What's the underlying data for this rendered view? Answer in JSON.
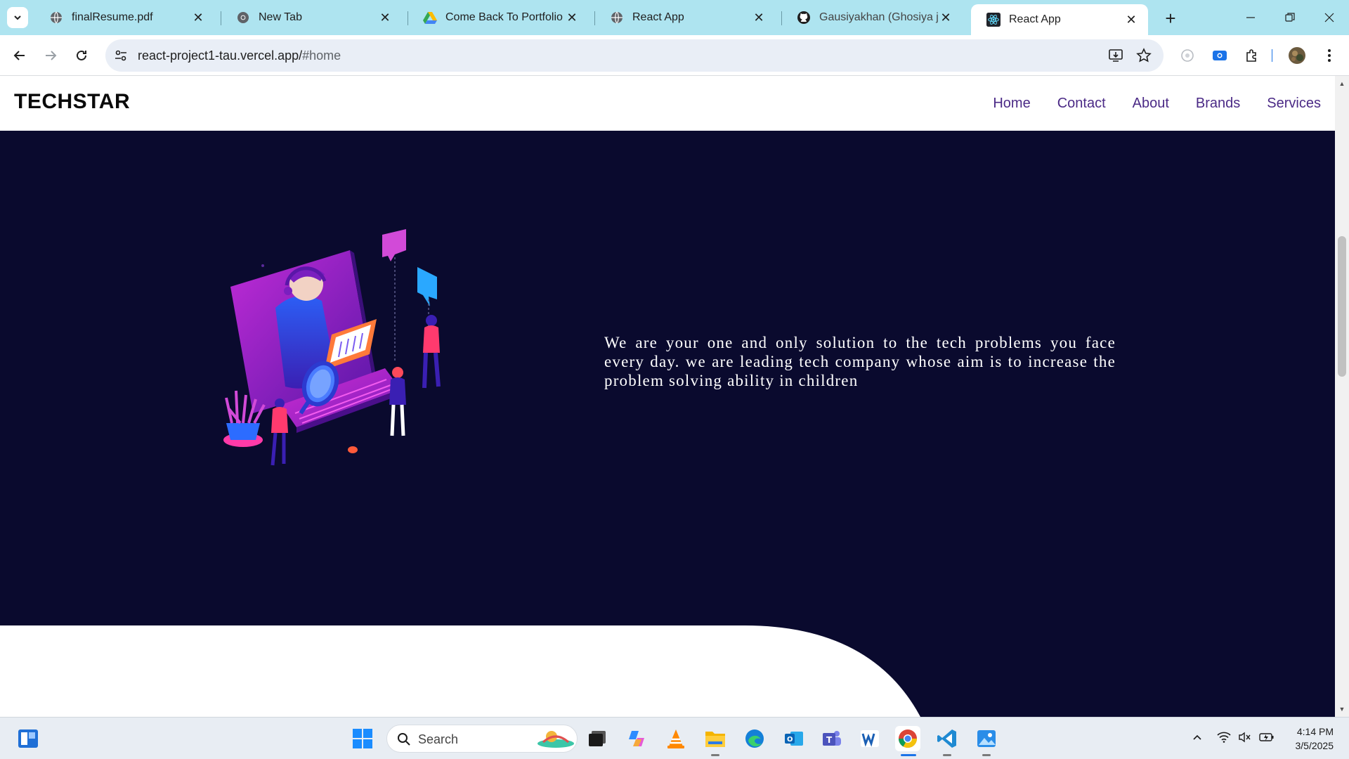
{
  "browser": {
    "tabs": [
      {
        "title": "finalResume.pdf",
        "icon": "globe-icon",
        "active": false
      },
      {
        "title": "New Tab",
        "icon": "chrome-icon",
        "active": false
      },
      {
        "title": "Come Back To Portfolio",
        "icon": "drive-icon",
        "active": false
      },
      {
        "title": "React App",
        "icon": "globe-icon",
        "active": false
      },
      {
        "title": "Gausiyakhan (Ghosiya jabb",
        "icon": "github-icon",
        "active": false
      },
      {
        "title": "React App",
        "icon": "react-icon",
        "active": true
      }
    ],
    "address": {
      "host": "react-project1-tau.vercel.app/",
      "path": "#home"
    }
  },
  "page": {
    "brand": "TECHSTAR",
    "nav": [
      "Home",
      "Contact",
      "About",
      "Brands",
      "Services"
    ],
    "hero_text": "We are your one and only solution to the tech problems you face every day. we are leading tech company whose aim is to increase the problem solving ability in children"
  },
  "taskbar": {
    "search_label": "Search",
    "time": "4:14 PM",
    "date": "3/5/2025"
  },
  "colors": {
    "hero_bg": "#0a0a2e",
    "nav_link": "#4b2a86",
    "tabstrip": "#aee4f0"
  }
}
